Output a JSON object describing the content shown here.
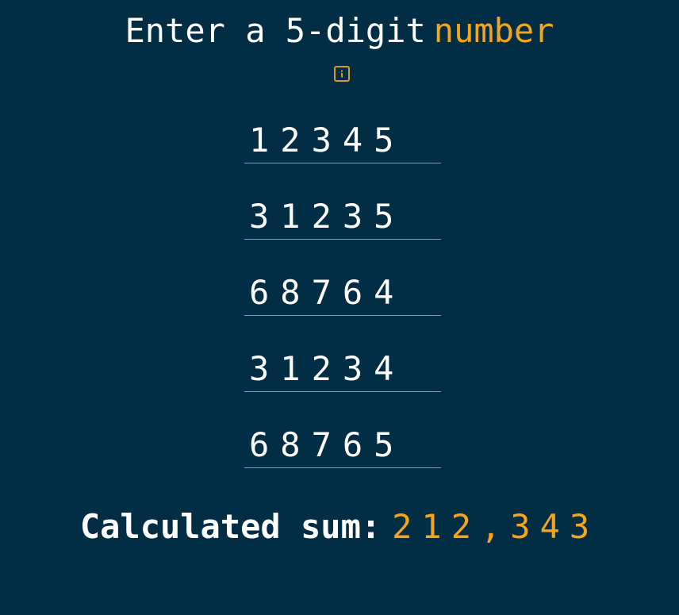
{
  "header": {
    "title_lead": "Enter a 5-digit",
    "title_accent": "number",
    "info_icon": "info-icon"
  },
  "inputs": [
    {
      "value": "12345"
    },
    {
      "value": "31235"
    },
    {
      "value": "68764"
    },
    {
      "value": "31234"
    },
    {
      "value": "68765"
    }
  ],
  "result": {
    "label": "Calculated sum:",
    "value": "212,343"
  },
  "colors": {
    "background": "#022e45",
    "accent": "#f4a51c",
    "underline": "#e08a1e",
    "text": "#ffffff"
  }
}
